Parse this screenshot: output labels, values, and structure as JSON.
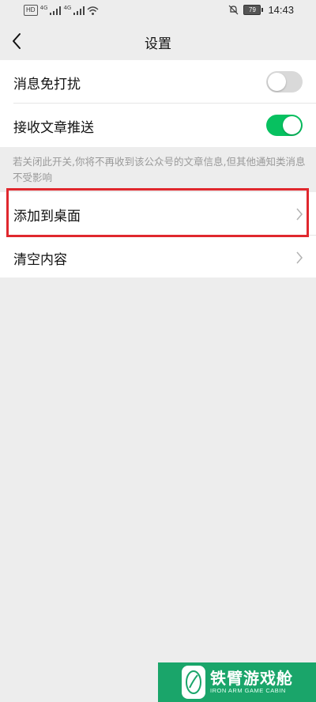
{
  "status_bar": {
    "hd_label": "HD",
    "network_1": "4G",
    "network_2": "4G",
    "battery_level": "79",
    "time": "14:43",
    "icons": [
      "hd-icon",
      "signal-icon",
      "signal-icon",
      "wifi-icon",
      "mute-bell-icon",
      "battery-icon"
    ]
  },
  "nav": {
    "back_icon": "chevron-left-icon",
    "title": "设置"
  },
  "settings": {
    "group1": [
      {
        "label": "消息免打扰",
        "toggle": "off"
      },
      {
        "label": "接收文章推送",
        "toggle": "on"
      }
    ],
    "hint": "若关闭此开关,你将不再收到该公众号的文章信息,但其他通知类消息不受影响",
    "group2": [
      {
        "label": "添加到桌面",
        "icon": "chevron-right-icon",
        "highlighted": true
      },
      {
        "label": "清空内容",
        "icon": "chevron-right-icon"
      }
    ]
  },
  "colors": {
    "accent_green": "#07c160",
    "highlight_red": "#e0282e",
    "background": "#ededed"
  },
  "watermark": {
    "title": "铁臂游戏舱",
    "subtitle": "IRON ARM GAME CABIN"
  }
}
